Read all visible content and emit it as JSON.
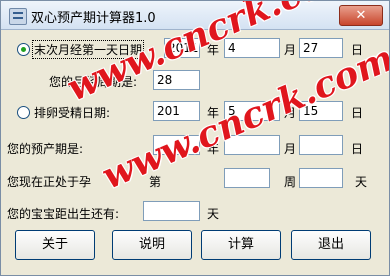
{
  "window": {
    "title": "双心预产期计算器1.0",
    "close_glyph": "✕"
  },
  "form": {
    "lmp_label": "末次月经第一天日期",
    "lmp_year": "2011",
    "lmp_month": "4",
    "lmp_day": "27",
    "cycle_label": "您的月经周期是:",
    "cycle_value": "28",
    "ovulation_label": "排卵受精日期:",
    "ovu_year": "201",
    "ovu_month": "5",
    "ovu_day": "15",
    "due_label": "您的预产期是:",
    "due_year": "",
    "due_month": "",
    "due_day": "",
    "week_label": "您现在正处于孕",
    "week_label2": "第",
    "week_value": "",
    "day_value": "",
    "countdown_label": "您的宝宝距出生还有:",
    "countdown_value": "",
    "unit_year": "年",
    "unit_month": "月",
    "unit_day": "日",
    "unit_week": "周",
    "unit_days": "天"
  },
  "buttons": {
    "about": "关于",
    "help": "说明",
    "calculate": "计算",
    "exit": "退出"
  },
  "watermark": {
    "text": "www.cncrk.com",
    "color": "#e0161d"
  }
}
